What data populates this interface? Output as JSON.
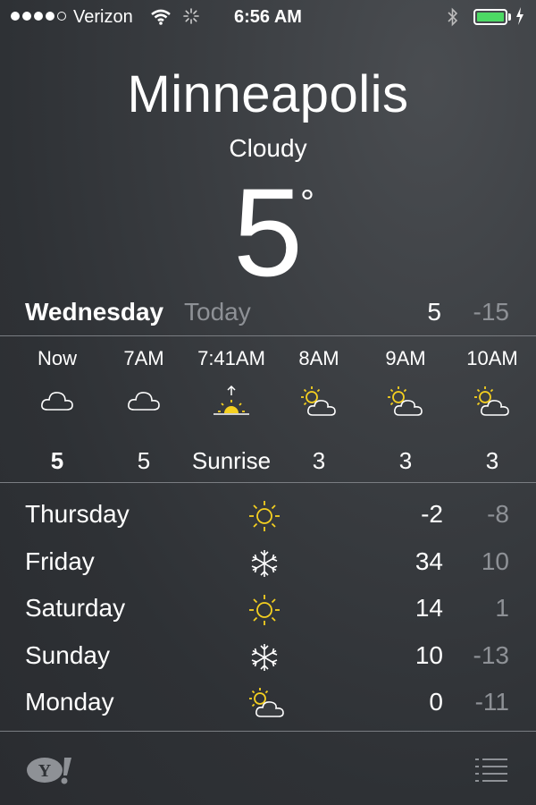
{
  "status_bar": {
    "carrier": "Verizon",
    "time": "6:56 AM",
    "signal_bars_filled": 4,
    "signal_bars_total": 5,
    "battery_color": "#4cd964",
    "battery_level": 1.0
  },
  "location": {
    "city": "Minneapolis",
    "condition": "Cloudy",
    "temperature": "5",
    "degree_symbol": "°"
  },
  "today": {
    "day": "Wednesday",
    "label": "Today",
    "high": "5",
    "low": "-15"
  },
  "hourly": [
    {
      "time": "Now",
      "icon": "cloud-icon",
      "value": "5",
      "bold": true
    },
    {
      "time": "7AM",
      "icon": "cloud-icon",
      "value": "5",
      "bold": false
    },
    {
      "time": "7:41AM",
      "icon": "sunrise-icon",
      "value": "Sunrise",
      "bold": false
    },
    {
      "time": "8AM",
      "icon": "partly-cloudy-icon",
      "value": "3",
      "bold": false
    },
    {
      "time": "9AM",
      "icon": "partly-cloudy-icon",
      "value": "3",
      "bold": false
    },
    {
      "time": "10AM",
      "icon": "partly-cloudy-icon",
      "value": "3",
      "bold": false
    }
  ],
  "forecast": [
    {
      "day": "Thursday",
      "icon": "sun-icon",
      "high": "-2",
      "low": "-8"
    },
    {
      "day": "Friday",
      "icon": "snowflake-icon",
      "high": "34",
      "low": "10"
    },
    {
      "day": "Saturday",
      "icon": "sun-icon",
      "high": "14",
      "low": "1"
    },
    {
      "day": "Sunday",
      "icon": "snowflake-icon",
      "high": "10",
      "low": "-13"
    },
    {
      "day": "Monday",
      "icon": "partly-cloudy-icon",
      "high": "0",
      "low": "-11"
    }
  ],
  "footer": {
    "yahoo_logo_text": "Y!",
    "menu_icon": "list-icon"
  },
  "colors": {
    "sun": "#f5d020",
    "muted": "#8e9196"
  }
}
